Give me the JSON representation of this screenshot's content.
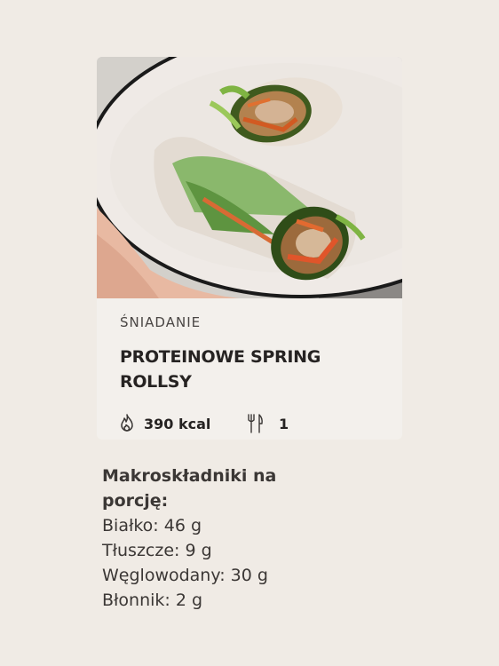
{
  "recipe_card": {
    "image_alt": "Proteinowe spring rollsy na talerzu",
    "category": "ŚNIADANIE",
    "title": "PROTEINOWE SPRING ROLLSY",
    "calories": "390 kcal",
    "servings": "1",
    "icons": {
      "calories": "flame-icon",
      "servings": "cutlery-icon"
    }
  },
  "macros": {
    "heading": "Makroskładniki na porcję:",
    "items": [
      "Białko: 46 g",
      "Tłuszcze: 9 g",
      "Węglowodany: 30 g",
      "Błonnik: 2 g"
    ]
  },
  "colors": {
    "page_background": "#f0ebe5",
    "card_background": "#f3f0ec",
    "text_dark": "#262322",
    "plate_rim": "#1a1a1a"
  }
}
